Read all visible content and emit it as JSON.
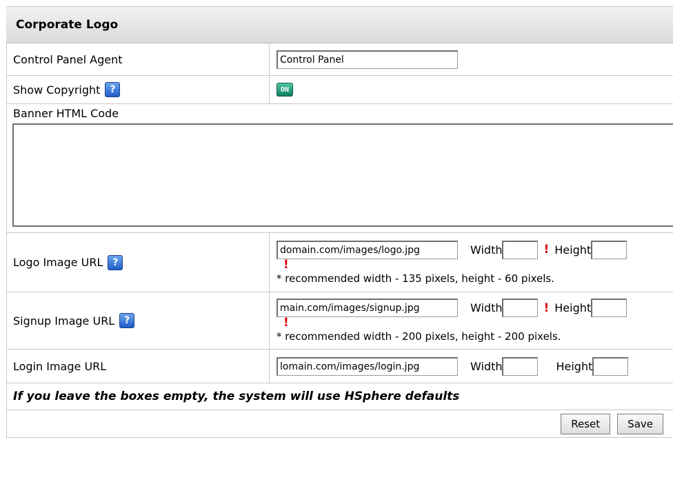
{
  "section": {
    "title": "Corporate Logo"
  },
  "agent": {
    "label": "Control Panel Agent",
    "value": "Control Panel"
  },
  "copyright": {
    "label": "Show Copyright",
    "toggle_text": "ON",
    "help": "?"
  },
  "banner": {
    "label": "Banner HTML Code",
    "value": ""
  },
  "logo": {
    "label": "Logo Image URL",
    "help": "?",
    "url": "domain.com/images/logo.jpg",
    "width_label": "Width",
    "height_label": "Height",
    "required_mark": "!",
    "note": "* recommended width - 135 pixels, height - 60 pixels."
  },
  "signup": {
    "label": "Signup Image URL",
    "help": "?",
    "url": "main.com/images/signup.jpg",
    "width_label": "Width",
    "height_label": "Height",
    "required_mark": "!",
    "note": "* recommended width - 200 pixels, height - 200 pixels."
  },
  "login": {
    "label": "Login Image URL",
    "url": "lomain.com/images/login.jpg",
    "width_label": "Width",
    "height_label": "Height"
  },
  "footer_note": "If you leave the boxes empty, the system will use HSphere defaults",
  "buttons": {
    "reset": "Reset",
    "save": "Save"
  }
}
